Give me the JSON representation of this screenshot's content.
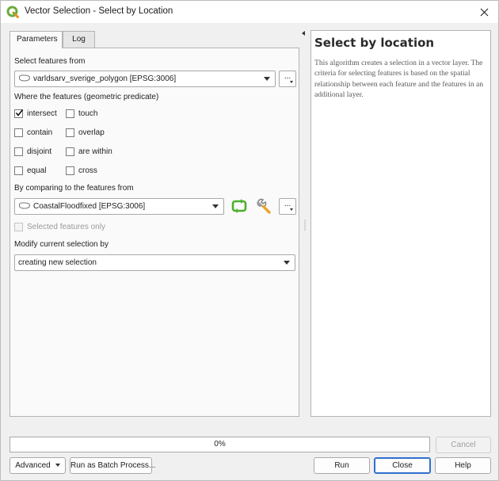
{
  "window": {
    "title": "Vector Selection - Select by Location",
    "icon": "qgis-logo-icon",
    "accent_color": "#2f6fd0"
  },
  "tabs": [
    {
      "label": "Parameters",
      "active": true
    },
    {
      "label": "Log",
      "active": false
    }
  ],
  "params": {
    "select_from_label": "Select features from",
    "input_layer": "varldsarv_sverige_polygon [EPSG:3006]",
    "predicate_label": "Where the features (geometric predicate)",
    "predicates": [
      {
        "label": "intersect",
        "checked": true
      },
      {
        "label": "touch",
        "checked": false
      },
      {
        "label": "contain",
        "checked": false
      },
      {
        "label": "overlap",
        "checked": false
      },
      {
        "label": "disjoint",
        "checked": false
      },
      {
        "label": "are within",
        "checked": false
      },
      {
        "label": "equal",
        "checked": false
      },
      {
        "label": "cross",
        "checked": false
      }
    ],
    "compare_label": "By comparing to the features from",
    "compare_layer": "CoastalFloodfixed [EPSG:3006]",
    "selected_only_label": "Selected features only",
    "modify_label": "Modify current selection by",
    "modify_value": "creating new selection",
    "dots_label": "..."
  },
  "help": {
    "title": "Select by location",
    "text": "This algorithm creates a selection in a vector layer. The criteria for selecting features is based on the spatial relationship between each feature and the features in an additional layer."
  },
  "progress": {
    "text": "0%",
    "value": 0
  },
  "buttons": {
    "cancel": "Cancel",
    "advanced": "Advanced",
    "batch": "Run as Batch Process...",
    "run": "Run",
    "close": "Close",
    "help": "Help"
  }
}
